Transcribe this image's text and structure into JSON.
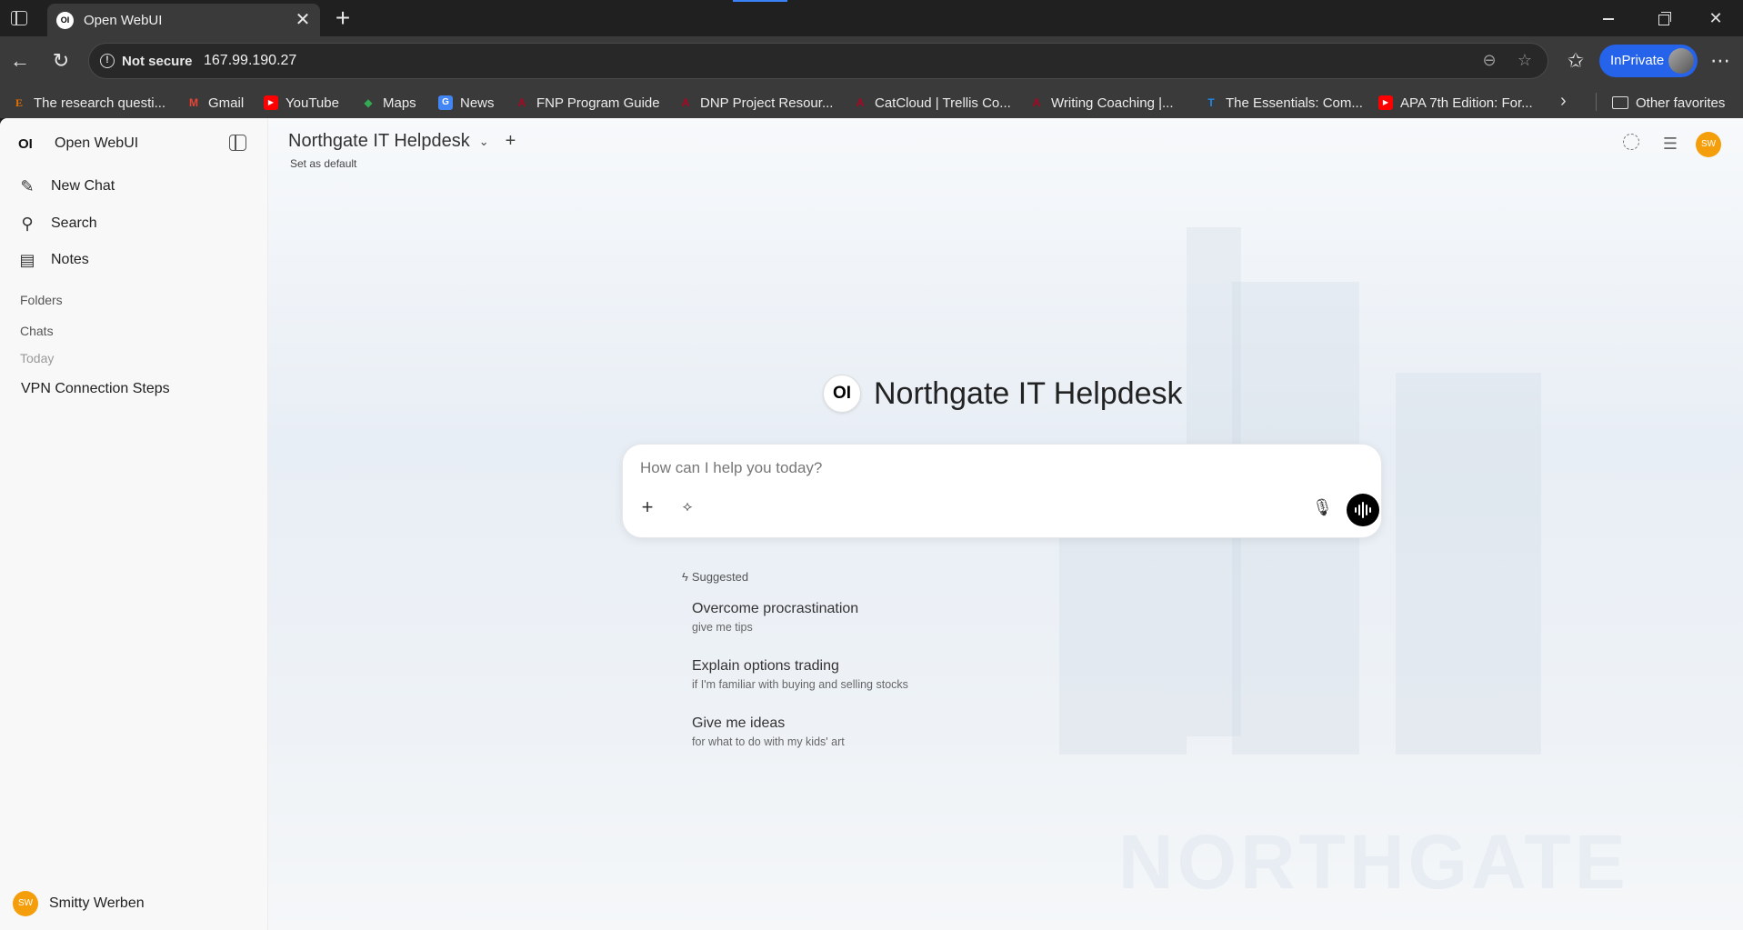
{
  "browser": {
    "tab_title": "Open WebUI",
    "tab_favicon_text": "OI",
    "not_secure_label": "Not secure",
    "url": "167.99.190.27",
    "inprivate_label": "InPrivate",
    "bookmarks": [
      {
        "label": "The research questi...",
        "icon": "E",
        "color": "#e76f00"
      },
      {
        "label": "Gmail",
        "icon": "M",
        "color": "#ea4335"
      },
      {
        "label": "YouTube",
        "icon": "▶",
        "color": "#ff0000"
      },
      {
        "label": "Maps",
        "icon": "◆",
        "color": "#34a853"
      },
      {
        "label": "News",
        "icon": "G",
        "color": "#4285f4"
      },
      {
        "label": "FNP Program Guide",
        "icon": "A",
        "color": "#ab0520"
      },
      {
        "label": "DNP Project Resour...",
        "icon": "A",
        "color": "#ab0520"
      },
      {
        "label": "CatCloud | Trellis Co...",
        "icon": "A",
        "color": "#ab0520"
      },
      {
        "label": "Writing Coaching |...",
        "icon": "A",
        "color": "#ab0520"
      },
      {
        "label": "The Essentials: Com...",
        "icon": "T",
        "color": "#1e88e5"
      },
      {
        "label": "APA 7th Edition: For...",
        "icon": "▶",
        "color": "#ff0000"
      }
    ],
    "other_favorites": "Other favorites"
  },
  "sidebar": {
    "logo_text": "OI",
    "app_name": "Open WebUI",
    "items": [
      {
        "label": "New Chat",
        "icon": "edit-icon"
      },
      {
        "label": "Search",
        "icon": "search-icon"
      },
      {
        "label": "Notes",
        "icon": "notes-icon"
      }
    ],
    "folders_label": "Folders",
    "chats_label": "Chats",
    "today_label": "Today",
    "chats": [
      "VPN Connection Steps"
    ],
    "user": {
      "initials": "SW",
      "name": "Smitty Werben"
    }
  },
  "main": {
    "model_name": "Northgate IT Helpdesk",
    "set_default": "Set as default",
    "avatar_initials": "SW",
    "hero_logo": "OI",
    "hero_title": "Northgate IT Helpdesk",
    "composer_placeholder": "How can I help you today?",
    "suggested_label": "Suggested",
    "suggestions": [
      {
        "title": "Overcome procrastination",
        "sub": "give me tips"
      },
      {
        "title": "Explain options trading",
        "sub": "if I'm familiar with buying and selling stocks"
      },
      {
        "title": "Give me ideas",
        "sub": "for what to do with my kids' art"
      }
    ],
    "watermark": "NORTHGATE"
  },
  "colors": {
    "accent": "#2563eb",
    "avatar": "#f59e0b"
  }
}
